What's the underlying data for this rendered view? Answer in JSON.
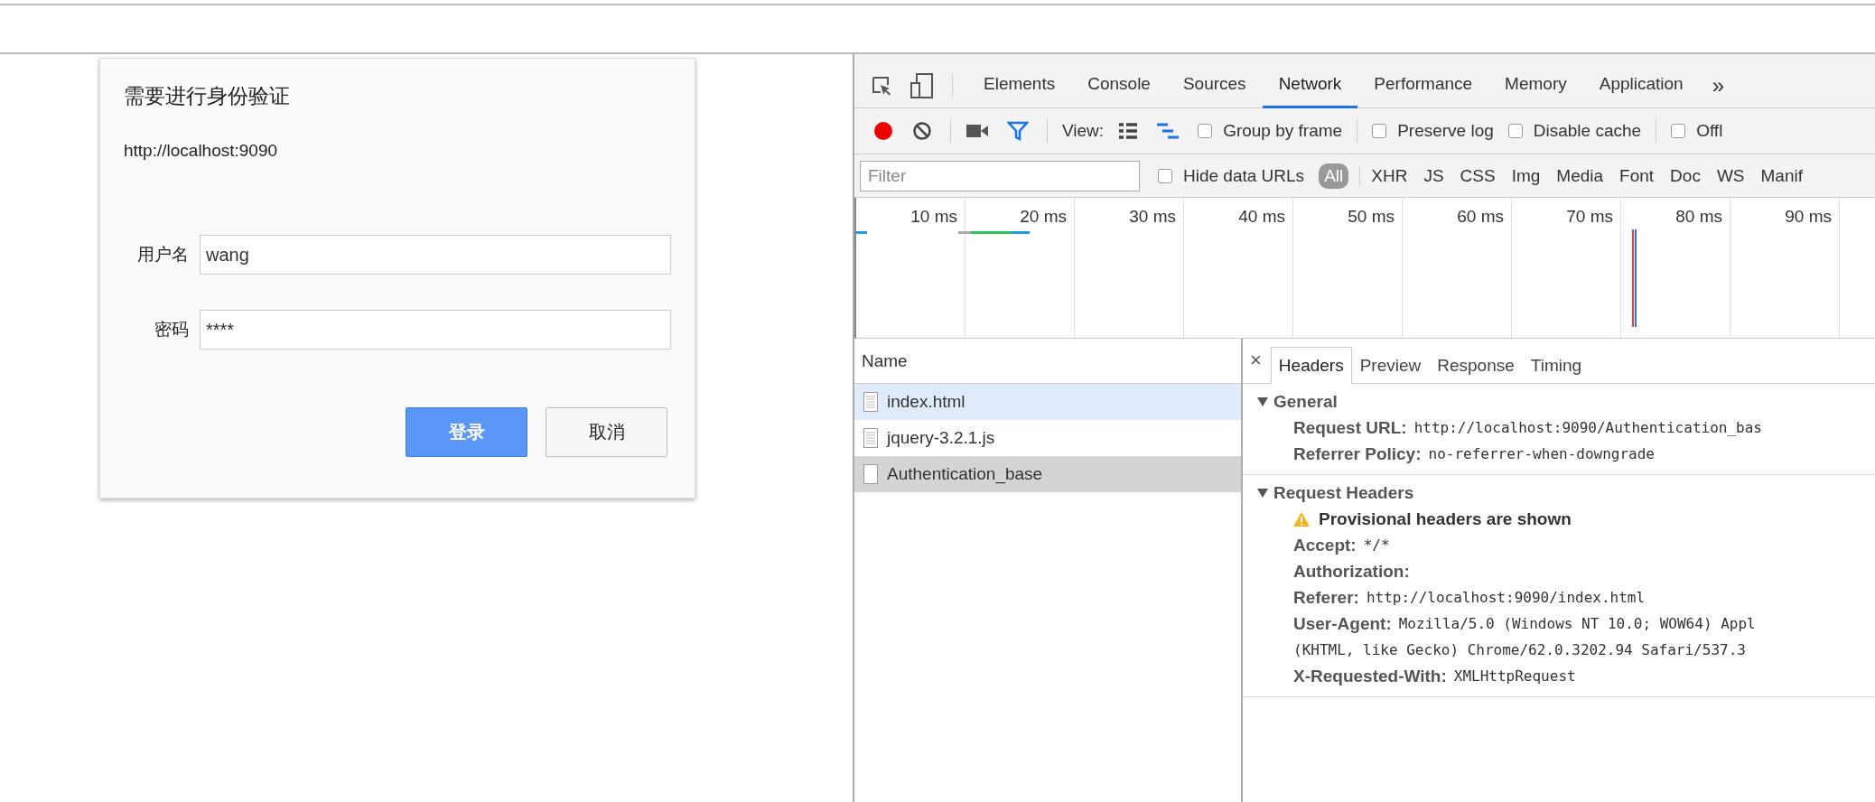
{
  "auth_dialog": {
    "title": "需要进行身份验证",
    "origin": "http://localhost:9090",
    "fields": [
      {
        "label": "用户名",
        "value": "wang"
      },
      {
        "label": "密码",
        "value": "****"
      }
    ],
    "buttons": [
      {
        "label": "登录",
        "primary": true
      },
      {
        "label": "取消",
        "primary": false
      }
    ]
  },
  "devtools": {
    "tabs": [
      {
        "label": "Elements",
        "selected": false
      },
      {
        "label": "Console",
        "selected": false
      },
      {
        "label": "Sources",
        "selected": false
      },
      {
        "label": "Network",
        "selected": true
      },
      {
        "label": "Performance",
        "selected": false
      },
      {
        "label": "Memory",
        "selected": false
      },
      {
        "label": "Application",
        "selected": false
      }
    ],
    "more_tabs": "»",
    "toolbar": {
      "recording": true,
      "view_label": "View:",
      "checkboxes": [
        {
          "label": "Group by frame",
          "checked": false
        },
        {
          "label": "Preserve log",
          "checked": false
        },
        {
          "label": "Disable cache",
          "checked": false
        },
        {
          "label": "Offl",
          "checked": false
        }
      ]
    },
    "filter": {
      "placeholder": "Filter",
      "hide_data_urls": {
        "label": "Hide data URLs",
        "checked": false
      },
      "types": [
        {
          "label": "All",
          "selected": true
        },
        {
          "label": "XHR",
          "selected": false
        },
        {
          "label": "JS",
          "selected": false
        },
        {
          "label": "CSS",
          "selected": false
        },
        {
          "label": "Img",
          "selected": false
        },
        {
          "label": "Media",
          "selected": false
        },
        {
          "label": "Font",
          "selected": false
        },
        {
          "label": "Doc",
          "selected": false
        },
        {
          "label": "WS",
          "selected": false
        },
        {
          "label": "Manif",
          "selected": false
        }
      ]
    },
    "timeline_ticks": [
      "10 ms",
      "20 ms",
      "30 ms",
      "40 ms",
      "50 ms",
      "60 ms",
      "70 ms",
      "80 ms",
      "90 ms"
    ],
    "requests": {
      "column": "Name",
      "rows": [
        {
          "name": "index.html",
          "kind": "document",
          "hovered": true,
          "selected": false
        },
        {
          "name": "jquery-3.2.1.js",
          "kind": "document",
          "hovered": false,
          "selected": false
        },
        {
          "name": "Authentication_base",
          "kind": "other",
          "hovered": false,
          "selected": true
        }
      ]
    },
    "details": {
      "close": "×",
      "tabs": [
        {
          "label": "Headers",
          "selected": true
        },
        {
          "label": "Preview",
          "selected": false
        },
        {
          "label": "Response",
          "selected": false
        },
        {
          "label": "Timing",
          "selected": false
        }
      ],
      "sections": [
        {
          "title": "General",
          "expanded": true,
          "items": [
            {
              "kind": "header",
              "name": "Request URL:",
              "value_lines": [
                "http://localhost:9090/Authentication_bas"
              ]
            },
            {
              "kind": "header",
              "name": "Referrer Policy:",
              "value_lines": [
                "no-referrer-when-downgrade"
              ]
            }
          ]
        },
        {
          "title": "Request Headers",
          "expanded": true,
          "items": [
            {
              "kind": "warning",
              "name": "Provisional headers are shown"
            },
            {
              "kind": "header",
              "name": "Accept:",
              "value_lines": [
                "*/*"
              ]
            },
            {
              "kind": "header",
              "name": "Authorization:"
            },
            {
              "kind": "header",
              "name": "Referer:",
              "value_lines": [
                "http://localhost:9090/index.html"
              ]
            },
            {
              "kind": "header",
              "name": "User-Agent:",
              "value_lines": [
                "Mozilla/5.0 (Windows NT 10.0; WOW64) Appl",
                "(KHTML, like Gecko) Chrome/62.0.3202.94 Safari/537.3"
              ]
            },
            {
              "kind": "header",
              "name": "X-Requested-With:",
              "value_lines": [
                "XMLHttpRequest"
              ]
            }
          ]
        }
      ]
    }
  }
}
